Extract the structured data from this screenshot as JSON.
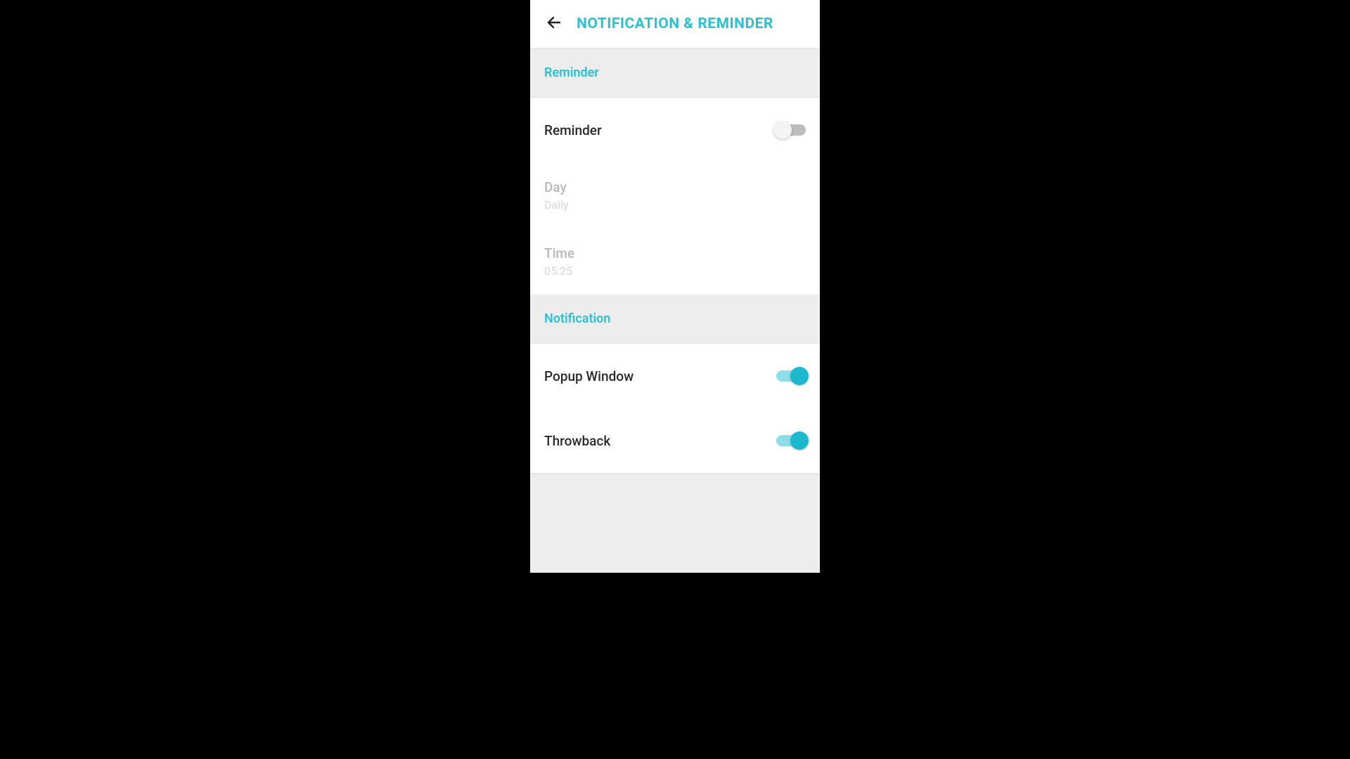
{
  "header": {
    "title": "NOTIFICATION & REMINDER"
  },
  "sections": {
    "reminder": {
      "header": "Reminder",
      "items": {
        "reminder_toggle": {
          "label": "Reminder",
          "on": false
        },
        "day": {
          "label": "Day",
          "value": "Daily"
        },
        "time": {
          "label": "Time",
          "value": "05:25"
        }
      }
    },
    "notification": {
      "header": "Notification",
      "items": {
        "popup": {
          "label": "Popup Window",
          "on": true
        },
        "throwback": {
          "label": "Throwback",
          "on": true
        }
      }
    }
  },
  "colors": {
    "accent": "#29c1d6"
  }
}
